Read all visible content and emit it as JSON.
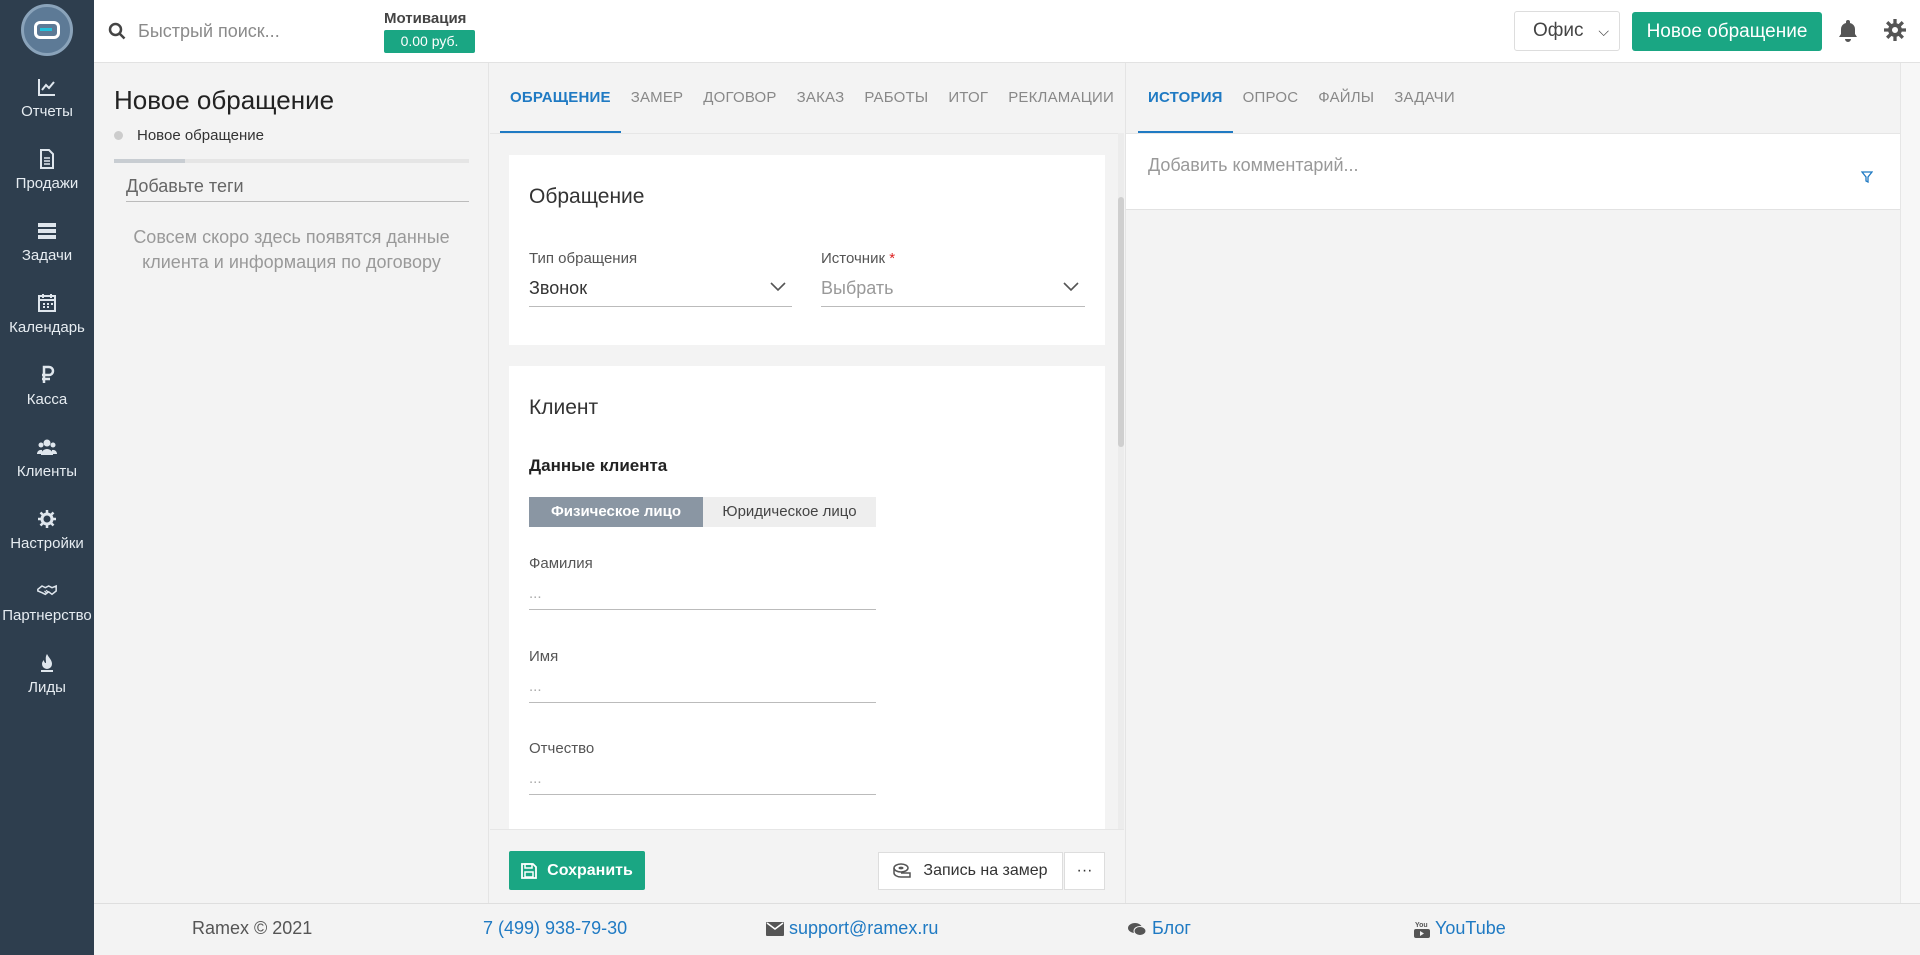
{
  "sidebar": {
    "items": [
      {
        "label": "Отчеты",
        "icon": "chart-icon"
      },
      {
        "label": "Продажи",
        "icon": "document-icon"
      },
      {
        "label": "Задачи",
        "icon": "tasks-icon"
      },
      {
        "label": "Календарь",
        "icon": "calendar-icon"
      },
      {
        "label": "Касса",
        "icon": "ruble-icon"
      },
      {
        "label": "Клиенты",
        "icon": "users-icon"
      },
      {
        "label": "Настройки",
        "icon": "gear-icon"
      },
      {
        "label": "Партнерство",
        "icon": "handshake-icon"
      },
      {
        "label": "Лиды",
        "icon": "flame-icon"
      }
    ]
  },
  "topbar": {
    "search_placeholder": "Быстрый поиск...",
    "motivation_label": "Мотивация",
    "motivation_value": "0.00 руб.",
    "office_value": "Офис",
    "new_request_label": "Новое обращение"
  },
  "left": {
    "title": "Новое обращение",
    "breadcrumb": "Новое обращение",
    "progress_fraction": 0.2,
    "tags_placeholder": "Добавьте теги",
    "info_message": "Совсем скоро здесь появятся данные клиента и информация по договору"
  },
  "middle": {
    "tabs": [
      "ОБРАЩЕНИЕ",
      "ЗАМЕР",
      "ДОГОВОР",
      "ЗАКАЗ",
      "РАБОТЫ",
      "ИТОГ",
      "РЕКЛАМАЦИИ"
    ],
    "active_tab": 0,
    "request_card": {
      "title": "Обращение",
      "type_label": "Тип обращения",
      "type_value": "Звонок",
      "source_label": "Источник",
      "source_required": "*",
      "source_placeholder": "Выбрать"
    },
    "client_card": {
      "title": "Клиент",
      "subheading": "Данные клиента",
      "toggle_individual": "Физическое лицо",
      "toggle_legal": "Юридическое лицо",
      "surname_label": "Фамилия",
      "surname_placeholder": "...",
      "name_label": "Имя",
      "name_placeholder": "...",
      "patronymic_label": "Отчество",
      "patronymic_placeholder": "..."
    },
    "actions": {
      "save_label": "Сохранить",
      "zamer_label": "Запись на замер",
      "more_label": "···"
    }
  },
  "right": {
    "tabs": [
      "ИСТОРИЯ",
      "ОПРОС",
      "ФАЙЛЫ",
      "ЗАДАЧИ"
    ],
    "active_tab": 0,
    "comment_placeholder": "Добавить комментарий..."
  },
  "footer": {
    "copyright": "Ramex © 2021",
    "phone": "7 (499) 938-79-30",
    "email": "support@ramex.ru",
    "blog": "Блог",
    "youtube": "YouTube"
  },
  "colors": {
    "sidebar_bg": "#2e3e4e",
    "accent_green": "#1aa683",
    "link_blue": "#1f7ac3"
  }
}
